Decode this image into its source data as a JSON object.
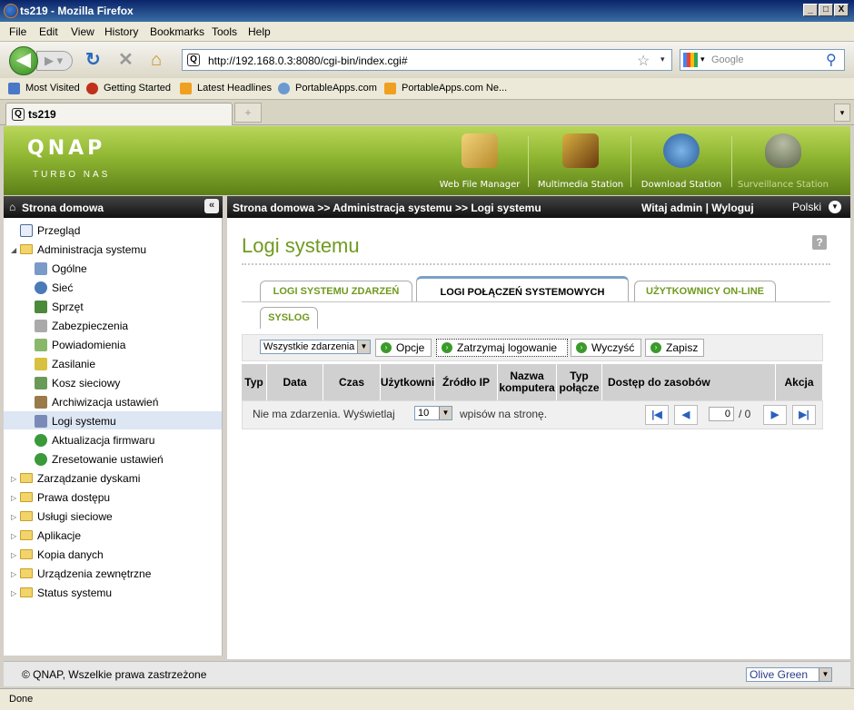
{
  "window": {
    "title": "ts219 - Mozilla Firefox",
    "min": "_",
    "max": "□",
    "close": "X"
  },
  "menu": [
    "File",
    "Edit",
    "View",
    "History",
    "Bookmarks",
    "Tools",
    "Help"
  ],
  "nav": {
    "url": "http://192.168.0.3:8080/cgi-bin/index.cgi#",
    "search_placeholder": "Google"
  },
  "bookmarks": [
    "Most Visited",
    "Getting Started",
    "Latest Headlines",
    "PortableApps.com",
    "PortableApps.com Ne..."
  ],
  "tab": {
    "title": "ts219"
  },
  "qnap": {
    "logo": "QNAP",
    "subtitle": "TURBO NAS"
  },
  "apps": [
    "Web File Manager",
    "Multimedia Station",
    "Download Station",
    "Surveillance Station"
  ],
  "left": {
    "title": "Strona domowa",
    "items": [
      {
        "label": "Przegląd"
      },
      {
        "label": "Administracja systemu"
      },
      {
        "label": "Ogólne"
      },
      {
        "label": "Sieć"
      },
      {
        "label": "Sprzęt"
      },
      {
        "label": "Zabezpieczenia"
      },
      {
        "label": "Powiadomienia"
      },
      {
        "label": "Zasilanie"
      },
      {
        "label": "Kosz sieciowy"
      },
      {
        "label": "Archiwizacja ustawień"
      },
      {
        "label": "Logi systemu"
      },
      {
        "label": "Aktualizacja firmwaru"
      },
      {
        "label": "Zresetowanie ustawień"
      },
      {
        "label": "Zarządzanie dyskami"
      },
      {
        "label": "Prawa dostępu"
      },
      {
        "label": "Usługi sieciowe"
      },
      {
        "label": "Aplikacje"
      },
      {
        "label": "Kopia danych"
      },
      {
        "label": "Urządzenia zewnętrzne"
      },
      {
        "label": "Status systemu"
      }
    ]
  },
  "header": {
    "breadcrumb": "Strona domowa >> Administracja systemu >> Logi systemu",
    "welcome": "Witaj admin | Wyloguj",
    "language": "Polski"
  },
  "page": {
    "title": "Logi systemu",
    "help": "?",
    "tabs": [
      "LOGI SYSTEMU ZDARZEŃ",
      "LOGI POŁĄCZEŃ SYSTEMOWYCH",
      "UŻYTKOWNICY ON-LINE",
      "SYSLOG"
    ],
    "filter_value": "Wszystkie zdarzenia",
    "buttons": [
      "Opcje",
      "Zatrzymaj logowanie",
      "Wyczyść",
      "Zapisz"
    ],
    "columns": [
      "Typ",
      "Data",
      "Czas",
      "Użytkowni",
      "Źródło IP",
      "Nazwa komputera",
      "Typ połącze",
      "Dostęp do zasobów",
      "Akcja"
    ],
    "empty_text": "Nie ma zdarzenia. Wyświetlaj",
    "per_page": "10",
    "per_page_suffix": "wpisów na stronę.",
    "page_current": "0",
    "page_total": "/ 0"
  },
  "footer": {
    "copyright": "© QNAP, Wszelkie prawa zastrzeżone",
    "theme": "Olive Green"
  },
  "status": "Done",
  "colors": {
    "accent": "#6f9a1f",
    "header_dark": "#222222",
    "selected": "#dde6f3"
  }
}
